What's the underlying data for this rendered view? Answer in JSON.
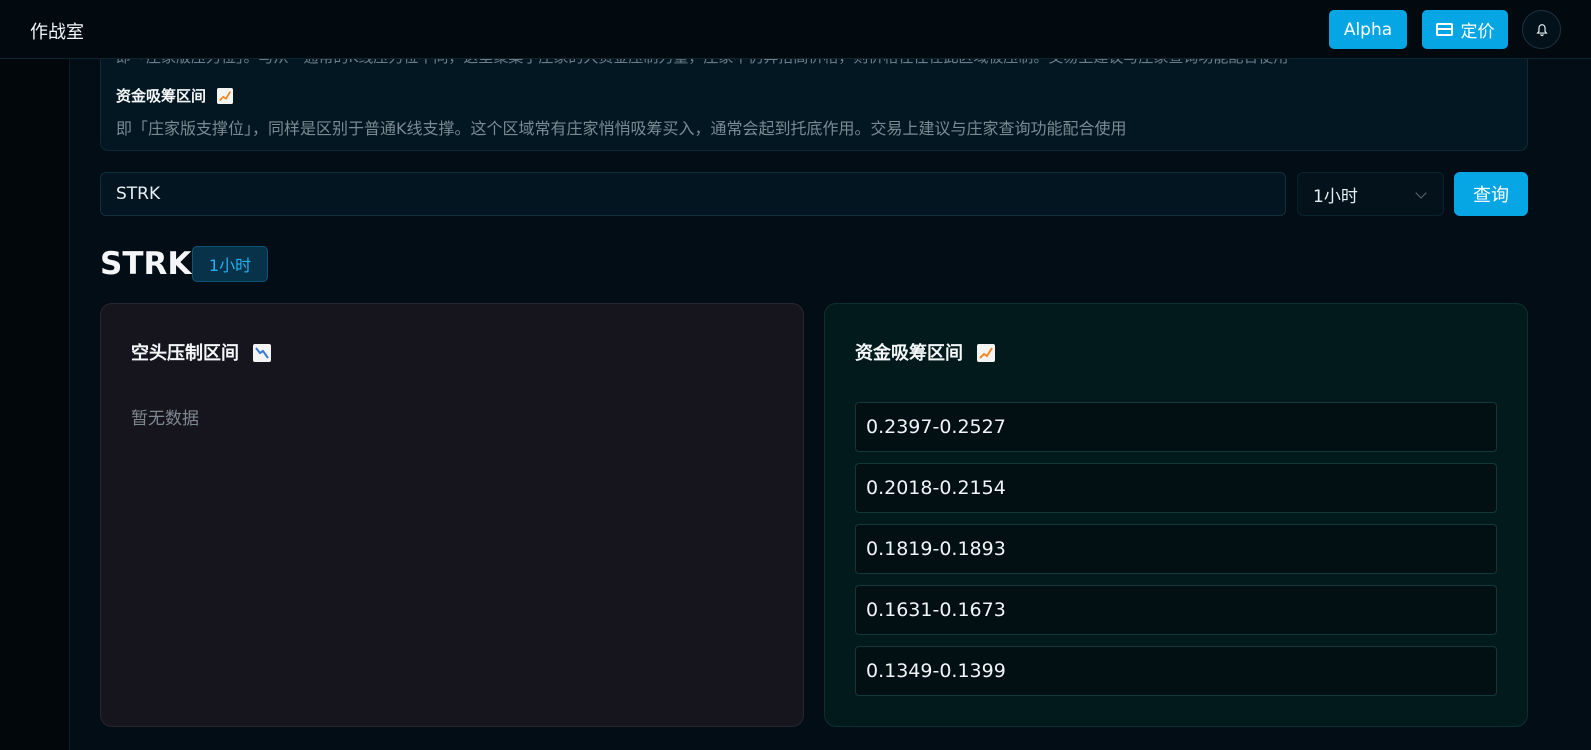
{
  "header": {
    "title": "作战室",
    "alpha_label": "Alpha",
    "pricing_label": "定价"
  },
  "info": {
    "line1_partial": "即「庄家版压力位」。与从一通常的K线压力位不同，这里聚集了庄家的大资金压制力量，庄家不仍奔抬高价格，则价格往往在此区域被压制。交易上建议与庄家查询功能配合使用",
    "support_heading": "资金吸筹区间",
    "support_desc": "即「庄家版支撑位」，同样是区别于普通K线支撑。这个区域常有庄家悄悄吸筹买入，通常会起到托底作用。交易上建议与庄家查询功能配合使用"
  },
  "search": {
    "value": "STRK",
    "interval": "1小时",
    "query_label": "查询"
  },
  "result": {
    "symbol": "STRK",
    "interval_tag": "1小时"
  },
  "resistance": {
    "title": "空头压制区间",
    "empty": "暂无数据"
  },
  "support": {
    "title": "资金吸筹区间",
    "zones": [
      "0.2397-0.2527",
      "0.2018-0.2154",
      "0.1819-0.1893",
      "0.1631-0.1673",
      "0.1349-0.1399"
    ]
  },
  "colors": {
    "accent": "#06a6e4",
    "down": "#e0544b",
    "up": "#f08a24"
  }
}
